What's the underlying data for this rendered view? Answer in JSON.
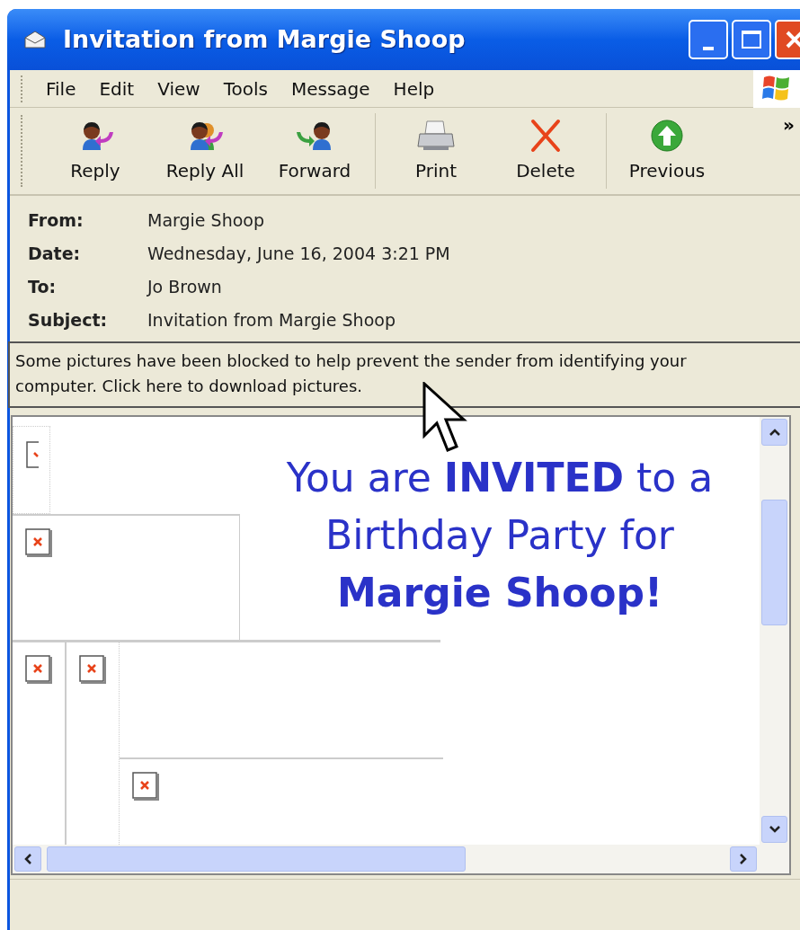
{
  "window": {
    "title": "Invitation from Margie Shoop"
  },
  "menu": [
    "File",
    "Edit",
    "View",
    "Tools",
    "Message",
    "Help"
  ],
  "toolbar": {
    "groups": [
      [
        {
          "label": "Reply",
          "kind": "reply"
        },
        {
          "label": "Reply All",
          "kind": "reply-all"
        },
        {
          "label": "Forward",
          "kind": "forward"
        }
      ],
      [
        {
          "label": "Print",
          "kind": "print"
        },
        {
          "label": "Delete",
          "kind": "delete"
        }
      ],
      [
        {
          "label": "Previous",
          "kind": "previous"
        }
      ]
    ],
    "overflow": "»"
  },
  "headers": [
    {
      "label": "From:",
      "value": "Margie Shoop"
    },
    {
      "label": "Date:",
      "value": "Wednesday, June 16, 2004 3:21 PM"
    },
    {
      "label": "To:",
      "value": "Jo Brown"
    },
    {
      "label": "Subject:",
      "value": "Invitation from Margie Shoop"
    }
  ],
  "info_bar": "Some pictures have been blocked to help prevent the sender from identifying your computer. Click here to download pictures.",
  "invitation": [
    "You are **INVITED** to a",
    "Birthday Party for",
    "**Margie Shoop!**"
  ]
}
